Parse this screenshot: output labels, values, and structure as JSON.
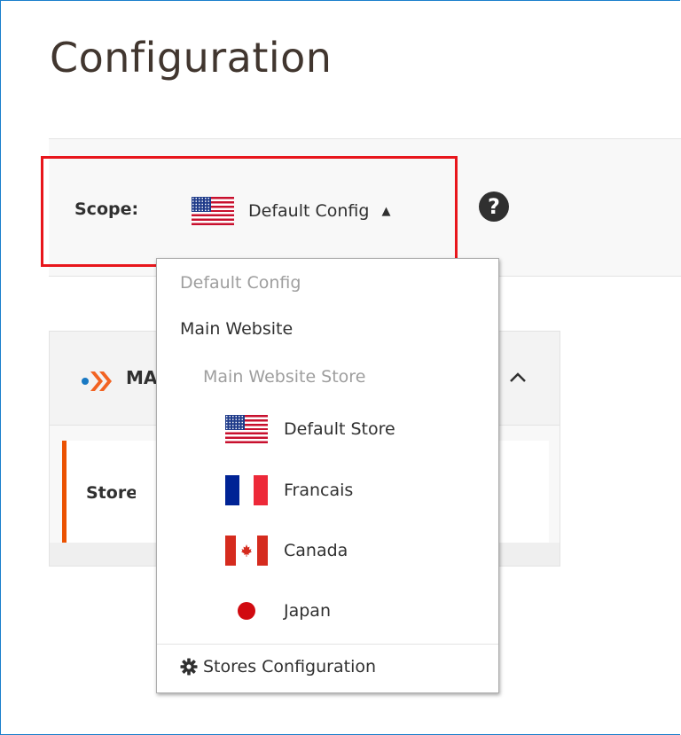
{
  "page": {
    "title": "Configuration"
  },
  "scope": {
    "label": "Scope:",
    "current": "Default Config",
    "help_glyph": "?",
    "flag_icon": "us-flag-icon"
  },
  "panel": {
    "title": "MA",
    "body_label": "Storev"
  },
  "dropdown": {
    "default_config": "Default Config",
    "website": "Main Website",
    "store_group": "Main Website Store",
    "stores": [
      {
        "label": "Default Store",
        "flag": "us-flag-icon"
      },
      {
        "label": "Francais",
        "flag": "fr-flag-icon"
      },
      {
        "label": "Canada",
        "flag": "ca-flag-icon"
      },
      {
        "label": "Japan",
        "flag": "jp-flag-icon"
      }
    ],
    "footer_link": "Stores Configuration"
  },
  "colors": {
    "accent": "#eb5202",
    "highlight": "#e8161c",
    "brand_blue": "#1979c3"
  }
}
